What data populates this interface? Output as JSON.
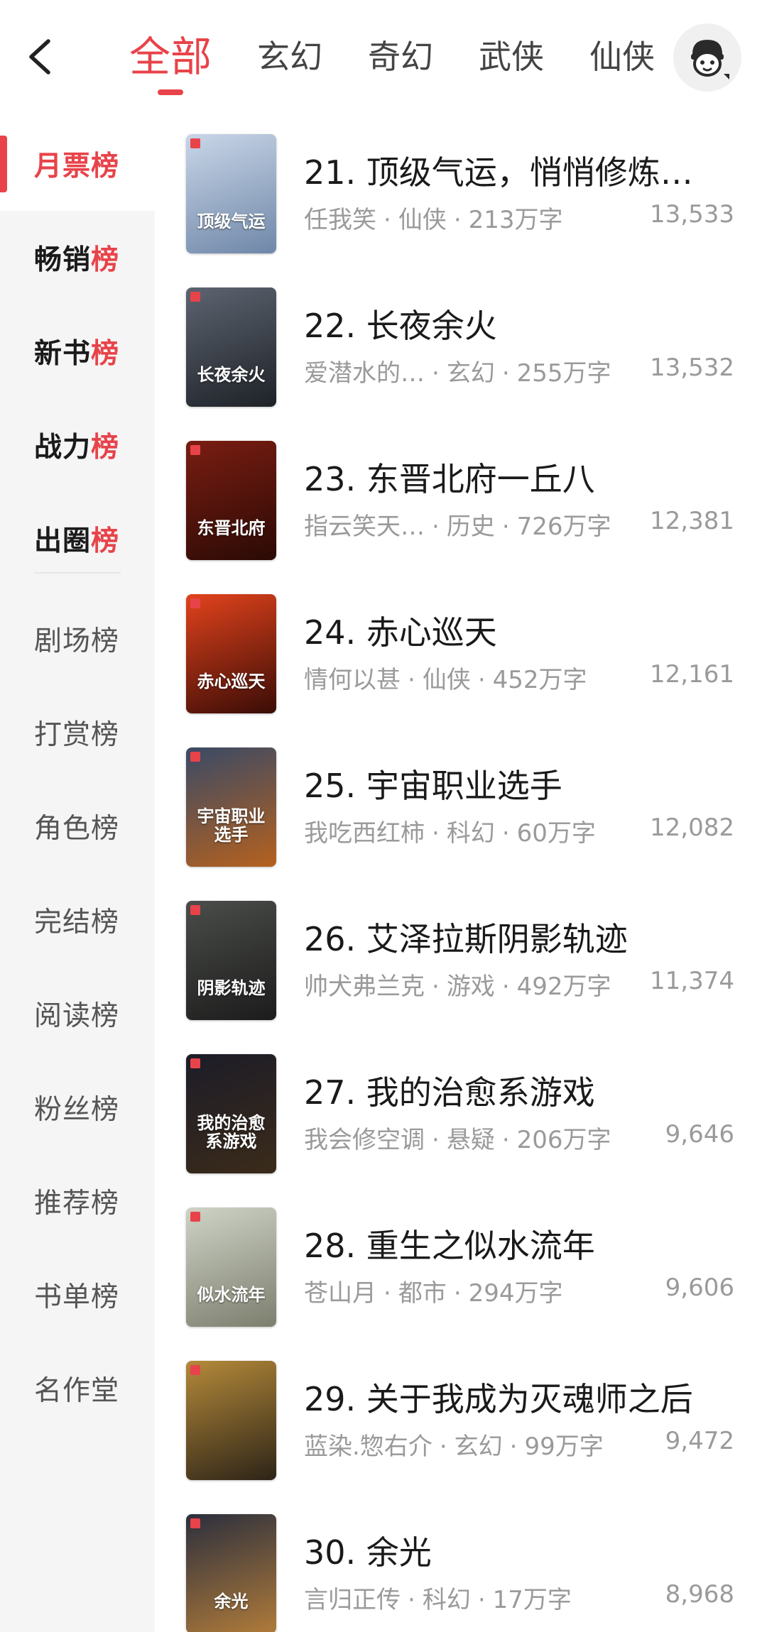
{
  "header": {
    "tabs": [
      {
        "label": "全部",
        "active": true
      },
      {
        "label": "玄幻",
        "active": false
      },
      {
        "label": "奇幻",
        "active": false
      },
      {
        "label": "武侠",
        "active": false
      },
      {
        "label": "仙侠",
        "active": false
      }
    ],
    "icons": {
      "back": "chevron-left-icon",
      "avatar": "user-avatar-icon"
    }
  },
  "sidebar": {
    "items": [
      {
        "label": "月票榜",
        "state": "active"
      },
      {
        "label": "畅销榜",
        "state": "bold"
      },
      {
        "label": "新书榜",
        "state": "bold"
      },
      {
        "label": "战力榜",
        "state": "bold"
      },
      {
        "label": "出圈榜",
        "state": "bold"
      },
      {
        "label": "剧场榜",
        "state": "normal"
      },
      {
        "label": "打赏榜",
        "state": "normal"
      },
      {
        "label": "角色榜",
        "state": "normal"
      },
      {
        "label": "完结榜",
        "state": "normal"
      },
      {
        "label": "阅读榜",
        "state": "normal"
      },
      {
        "label": "粉丝榜",
        "state": "normal"
      },
      {
        "label": "推荐榜",
        "state": "normal"
      },
      {
        "label": "书单榜",
        "state": "normal"
      },
      {
        "label": "名作堂",
        "state": "normal"
      }
    ]
  },
  "books": [
    {
      "title": "21. 顶级气运，悄悄修炼…",
      "author": "任我笑",
      "genre": "仙侠",
      "words": "213万字",
      "count": "13,533",
      "cover_text": "顶级气运",
      "cover_colors": [
        "#c9d6e8",
        "#6f87a8"
      ]
    },
    {
      "title": "22. 长夜余火",
      "author": "爱潜水的…",
      "genre": "玄幻",
      "words": "255万字",
      "count": "13,532",
      "cover_text": "长夜余火",
      "cover_colors": [
        "#5d6470",
        "#1e2228"
      ]
    },
    {
      "title": "23. 东晋北府一丘八",
      "author": "指云笑天…",
      "genre": "历史",
      "words": "726万字",
      "count": "12,381",
      "cover_text": "东晋北府",
      "cover_colors": [
        "#7a1d12",
        "#2b0a05"
      ]
    },
    {
      "title": "24. 赤心巡天",
      "author": "情何以甚",
      "genre": "仙侠",
      "words": "452万字",
      "count": "12,161",
      "cover_text": "赤心巡天",
      "cover_colors": [
        "#e2431c",
        "#3a0c06"
      ]
    },
    {
      "title": "25. 宇宙职业选手",
      "author": "我吃西红柿",
      "genre": "科幻",
      "words": "60万字",
      "count": "12,082",
      "cover_text": "宇宙职业选手",
      "cover_colors": [
        "#3a4a66",
        "#b5611e"
      ]
    },
    {
      "title": "26. 艾泽拉斯阴影轨迹",
      "author": "帅犬弗兰克",
      "genre": "游戏",
      "words": "492万字",
      "count": "11,374",
      "cover_text": "阴影轨迹",
      "cover_colors": [
        "#4b4d4a",
        "#1b1c1b"
      ]
    },
    {
      "title": "27. 我的治愈系游戏",
      "author": "我会修空调",
      "genre": "悬疑",
      "words": "206万字",
      "count": "9,646",
      "cover_text": "我的治愈系游戏",
      "cover_colors": [
        "#1c1c28",
        "#3b2b1a"
      ]
    },
    {
      "title": "28. 重生之似水流年",
      "author": "苍山月",
      "genre": "都市",
      "words": "294万字",
      "count": "9,606",
      "cover_text": "似水流年",
      "cover_colors": [
        "#cfd3c6",
        "#7c7f6e"
      ]
    },
    {
      "title": "29. 关于我成为灭魂师之后",
      "author": "蓝染.惣右介",
      "genre": "玄幻",
      "words": "99万字",
      "count": "9,472",
      "cover_text": "",
      "cover_colors": [
        "#b58a3a",
        "#2d2417"
      ]
    },
    {
      "title": "30. 余光",
      "author": "言归正传",
      "genre": "科幻",
      "words": "17万字",
      "count": "8,968",
      "cover_text": "余光",
      "cover_colors": [
        "#2b2f3d",
        "#b07b3a"
      ]
    }
  ],
  "colors": {
    "accent": "#e8434a",
    "sidebar_bg": "#f5f5f5",
    "meta_text": "#9a9a9a"
  }
}
